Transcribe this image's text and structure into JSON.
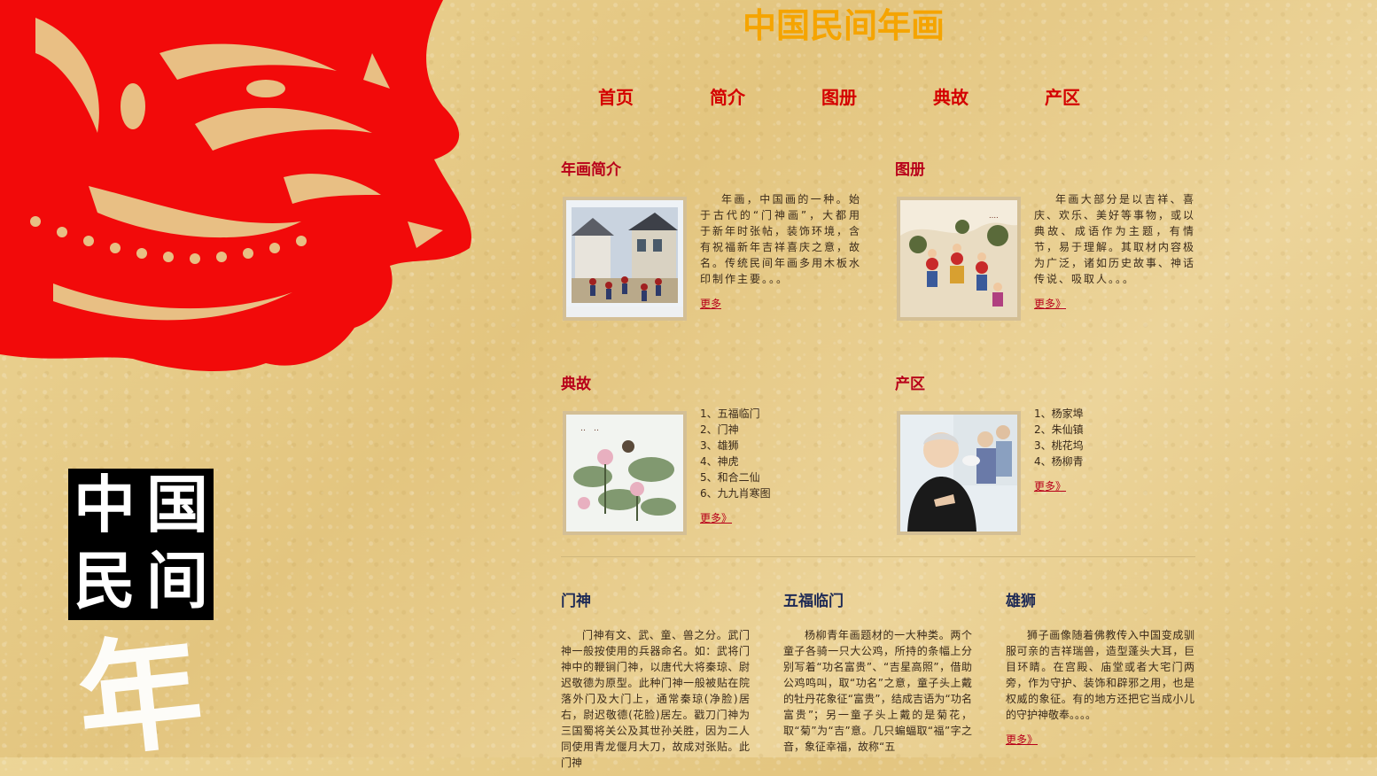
{
  "site": {
    "title": "中国民间年画"
  },
  "nav": {
    "items": [
      {
        "label": "首页"
      },
      {
        "label": "简介"
      },
      {
        "label": "图册"
      },
      {
        "label": "典故"
      },
      {
        "label": "产区"
      }
    ]
  },
  "decor": {
    "block_chars": [
      "中",
      "国",
      "民",
      "间"
    ],
    "large_char": "年"
  },
  "intro": {
    "title": "年画简介",
    "text": "年画，中国画的一种。始于古代的“门神画”，大都用于新年时张帖，装饰环境，含有祝福新年吉祥喜庆之意，故名。传统民间年画多用木板水印制作主要。。。",
    "more": "更多"
  },
  "album": {
    "title": "图册",
    "text": "年画大部分是以吉祥、喜庆、欢乐、美好等事物，或以典故、成语作为主题，有情节，易于理解。其取材内容极为广泛，诸如历史故事、神话传说、吸取人。。。",
    "more": "更多》"
  },
  "stories": {
    "title": "典故",
    "items": [
      "1、五福临门",
      "2、门神",
      "3、雄狮",
      "4、神虎",
      "5、和合二仙",
      "6、九九肖寒图"
    ],
    "more": "更多》"
  },
  "regions": {
    "title": "产区",
    "items": [
      "1、杨家埠",
      "2、朱仙镇",
      "3、桃花坞",
      "4、杨柳青"
    ],
    "more": "更多》"
  },
  "columns": [
    {
      "title": "门神",
      "text": "门神有文、武、童、兽之分。武门神一般按使用的兵器命名。如：武将门神中的鞭锏门神，以唐代大将秦琼、尉迟敬德为原型。此种门神一般被贴在院落外门及大门上，通常秦琼(净脸)居右，尉迟敬德(花脸)居左。戳刀门神为三国蜀将关公及其世孙关胜，因为二人同使用青龙偃月大刀，故成对张贴。此门神"
    },
    {
      "title": "五福临门",
      "text": "杨柳青年画题材的一大种类。两个童子各骑一只大公鸡，所持的条幅上分别写着“功名富贵”、“吉星高照”，借助公鸡鸣叫，取“功名”之意，童子头上戴的牡丹花象征“富贵”，结成吉语为“功名富贵”；另一童子头上戴的是菊花，取“菊”为“吉”意。几只蝙蝠取“福”字之音，象征幸福，故称“五"
    },
    {
      "title": "雄狮",
      "text": "狮子画像随着佛教传入中国变成驯服可亲的吉祥瑞兽，造型蓬头大耳，巨目环睛。在宫殿、庙堂或者大宅门两旁，作为守护、装饰和辟邪之用，也是权威的象征。有的地方还把它当成小儿的守护神敬奉。。。。",
      "more": "更多》"
    }
  ]
}
